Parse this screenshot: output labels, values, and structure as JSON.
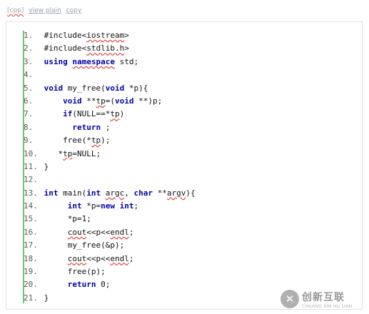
{
  "toolbar": {
    "tag": "[cpp]",
    "view_plain": "view plain",
    "copy": "copy"
  },
  "code_lines": [
    {
      "num": "1.",
      "parts": [
        {
          "t": " #include<"
        },
        {
          "t": "iostream",
          "c": "err"
        },
        {
          "t": ">"
        }
      ]
    },
    {
      "num": "2.",
      "parts": [
        {
          "t": " #include<"
        },
        {
          "t": "stdlib.h",
          "c": "err"
        },
        {
          "t": ">"
        }
      ]
    },
    {
      "num": "3.",
      "parts": [
        {
          "t": " "
        },
        {
          "t": "using",
          "c": "kw"
        },
        {
          "t": " "
        },
        {
          "t": "namespace",
          "c": "kw err"
        },
        {
          "t": " std;"
        }
      ]
    },
    {
      "num": "4.",
      "parts": [
        {
          "t": ""
        }
      ]
    },
    {
      "num": "5.",
      "parts": [
        {
          "t": " "
        },
        {
          "t": "void",
          "c": "kw"
        },
        {
          "t": " my_free("
        },
        {
          "t": "void",
          "c": "kw"
        },
        {
          "t": " *p){"
        }
      ]
    },
    {
      "num": "6.",
      "parts": [
        {
          "t": "     "
        },
        {
          "t": "void",
          "c": "kw"
        },
        {
          "t": " **"
        },
        {
          "t": "tp",
          "c": "err"
        },
        {
          "t": "=("
        },
        {
          "t": "void",
          "c": "kw"
        },
        {
          "t": " **)p;"
        }
      ]
    },
    {
      "num": "7.",
      "parts": [
        {
          "t": "     "
        },
        {
          "t": "if",
          "c": "kw"
        },
        {
          "t": "(NULL==*"
        },
        {
          "t": "tp",
          "c": "err"
        },
        {
          "t": ")"
        }
      ]
    },
    {
      "num": "8.",
      "parts": [
        {
          "t": "       "
        },
        {
          "t": "return",
          "c": "kw"
        },
        {
          "t": " ;"
        }
      ]
    },
    {
      "num": "9.",
      "parts": [
        {
          "t": "     free(*"
        },
        {
          "t": "tp",
          "c": "err"
        },
        {
          "t": ");"
        }
      ]
    },
    {
      "num": "10.",
      "parts": [
        {
          "t": "    *"
        },
        {
          "t": "tp",
          "c": "err"
        },
        {
          "t": "=NULL;"
        }
      ]
    },
    {
      "num": "11.",
      "parts": [
        {
          "t": " }"
        }
      ]
    },
    {
      "num": "12.",
      "parts": [
        {
          "t": ""
        }
      ]
    },
    {
      "num": "13.",
      "parts": [
        {
          "t": " "
        },
        {
          "t": "int",
          "c": "kw"
        },
        {
          "t": " main("
        },
        {
          "t": "int",
          "c": "kw"
        },
        {
          "t": " "
        },
        {
          "t": "argc",
          "c": "err"
        },
        {
          "t": ", "
        },
        {
          "t": "char",
          "c": "kw"
        },
        {
          "t": " **"
        },
        {
          "t": "argv",
          "c": "err"
        },
        {
          "t": "){"
        }
      ]
    },
    {
      "num": "14.",
      "parts": [
        {
          "t": "      "
        },
        {
          "t": "int",
          "c": "kw"
        },
        {
          "t": " *p="
        },
        {
          "t": "new",
          "c": "kw"
        },
        {
          "t": " "
        },
        {
          "t": "int",
          "c": "kw"
        },
        {
          "t": ";"
        }
      ]
    },
    {
      "num": "15.",
      "parts": [
        {
          "t": "      *p=1;"
        }
      ]
    },
    {
      "num": "16.",
      "parts": [
        {
          "t": "      "
        },
        {
          "t": "cout",
          "c": "err"
        },
        {
          "t": "<<p<<"
        },
        {
          "t": "endl",
          "c": "err"
        },
        {
          "t": ";"
        }
      ]
    },
    {
      "num": "17.",
      "parts": [
        {
          "t": "      my_free(&p);"
        }
      ]
    },
    {
      "num": "18.",
      "parts": [
        {
          "t": "      "
        },
        {
          "t": "cout",
          "c": "err"
        },
        {
          "t": "<<p<<"
        },
        {
          "t": "endl",
          "c": "err"
        },
        {
          "t": ";"
        }
      ]
    },
    {
      "num": "19.",
      "parts": [
        {
          "t": "      free(p);"
        }
      ]
    },
    {
      "num": "20.",
      "parts": [
        {
          "t": "      "
        },
        {
          "t": "return",
          "c": "kw"
        },
        {
          "t": " 0;"
        }
      ]
    },
    {
      "num": "21.",
      "parts": [
        {
          "t": " }"
        }
      ]
    }
  ],
  "watermark": {
    "logo_glyph": "✕",
    "cn": "创新互联",
    "en": "CHUANG XIN HU LIAN"
  },
  "colors": {
    "keyword": "#0000aa",
    "gutter": "#6cc56c",
    "spell_error": "#e03c3c"
  }
}
